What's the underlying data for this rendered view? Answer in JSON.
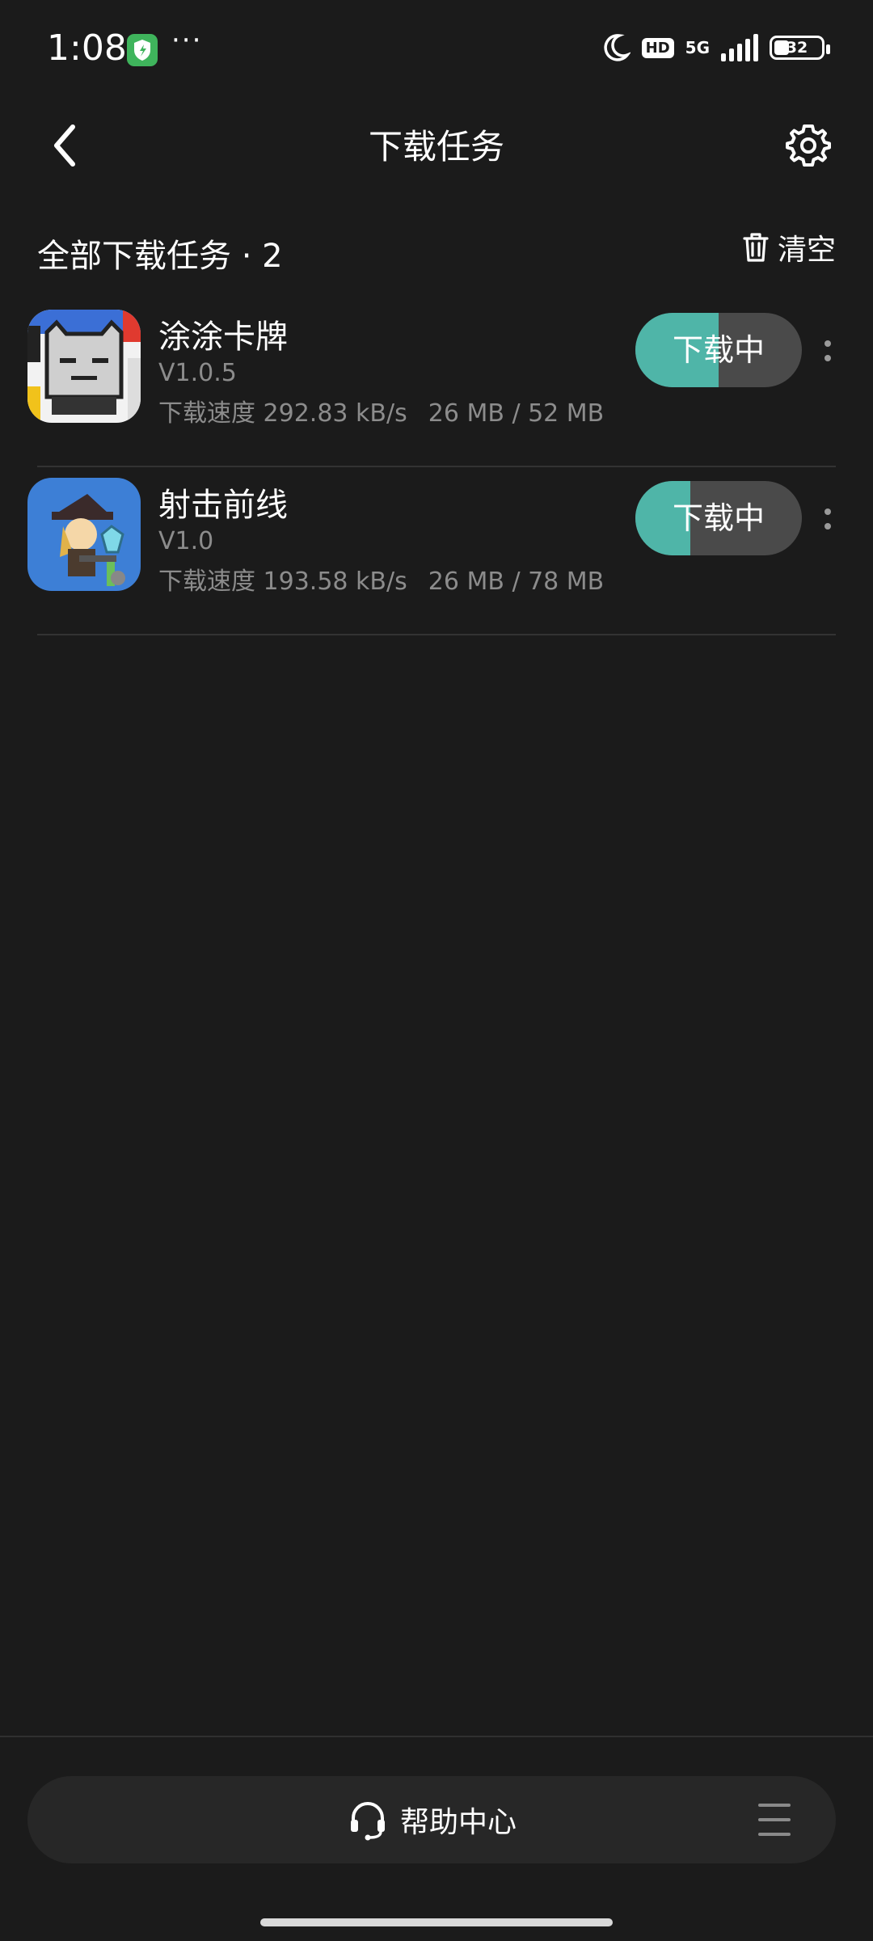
{
  "status_bar": {
    "time": "1:08",
    "dots": "···",
    "network": "5G",
    "hd": "HD",
    "battery_level": "32"
  },
  "header": {
    "title": "下载任务"
  },
  "section": {
    "title": "全部下载任务 · 2",
    "clear_label": "清空"
  },
  "tasks": [
    {
      "name": "涂涂卡牌",
      "version": "V1.0.5",
      "speed": "下载速度 292.83 kB/s",
      "size": "26 MB / 52 MB",
      "button_label": "下载中",
      "progress": 0.5
    },
    {
      "name": "射击前线",
      "version": "V1.0",
      "speed": "下载速度 193.58 kB/s",
      "size": "26 MB / 78 MB",
      "button_label": "下载中",
      "progress": 0.33
    }
  ],
  "footer": {
    "help_label": "帮助中心"
  },
  "colors": {
    "background": "#1b1b1b",
    "accent": "#4fb5a8",
    "button_track": "#4a4a4a",
    "secondary_text": "#8c8c8c"
  },
  "icons": [
    "back-arrow-icon",
    "settings-gear-icon",
    "trash-icon",
    "headset-icon",
    "menu-icon",
    "more-vertical-icon"
  ]
}
